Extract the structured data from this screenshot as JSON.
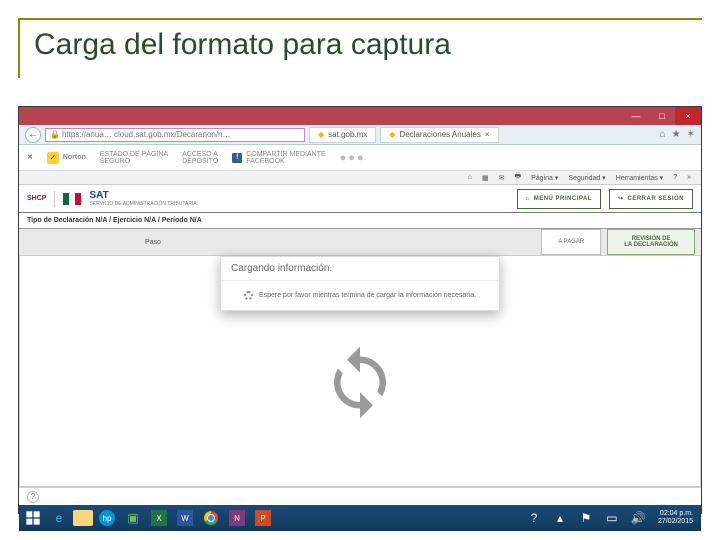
{
  "slide": {
    "title": "Carga del formato para captura"
  },
  "window": {
    "minimize": "—",
    "maximize": "□",
    "close": "×",
    "back_arrow": "←",
    "url": "https://anua… cloud.sat.gob.mx/Decaranon/n…",
    "tab1": "sat.gob.mx",
    "tab2": "Declaraciones Anuales",
    "icons": {
      "home": "⌂",
      "star": "★",
      "gear": "✶"
    }
  },
  "norton": {
    "brand": "Norton",
    "item1_l1": "ESTADO DE PÁGINA",
    "item1_l2": "SEGURO",
    "item2_l1": "ACCESO A",
    "item2_l2": "DEPÓSITO",
    "share_l1": "COMPARTIR MEDIANTE",
    "share_l2": "FACEBOOK"
  },
  "ie_tools": {
    "home": "⌂",
    "feeds": "▦",
    "mail": "✉",
    "print": "🖶",
    "page": "Página ▾",
    "safety": "Seguridad ▾",
    "tools": "Herramientas ▾",
    "help": "?",
    "chevrons": "»"
  },
  "sat": {
    "shcp": "SHCP",
    "sat": "SAT",
    "sat_sub": "SERVICIO DE ADMINISTRACIÓN TRIBUTARIA",
    "menu_btn": "MENÚ PRINCIPAL",
    "logout_btn": "CERRAR SESIÓN",
    "home_glyph": "⌂",
    "logout_glyph": "↪"
  },
  "breadcrumb": "Tipo de Declaración  N/A / Ejercicio  N/A / Período  N/A",
  "steps": {
    "paso": "Paso",
    "step2": "A PAGAR",
    "review_l1": "REVISIÓN DE",
    "review_l2": "LA DECLARACIÓN"
  },
  "modal": {
    "title": "Cargando información.",
    "body": "Espere por favor mientras termina de cargar la información necesaria."
  },
  "helpbar": {
    "q": "?"
  },
  "taskbar": {
    "time": "02:04 p.m.",
    "date": "27/02/2015"
  }
}
